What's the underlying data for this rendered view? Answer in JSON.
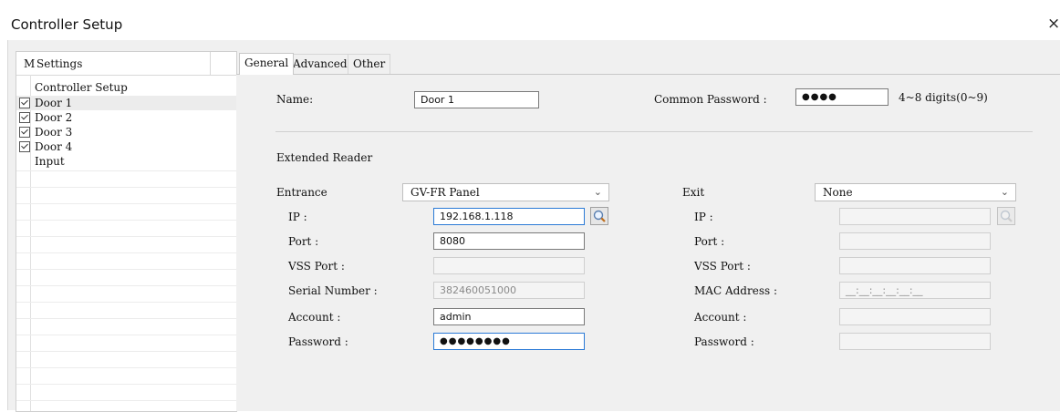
{
  "window": {
    "title": "Controller Setup",
    "close": "×"
  },
  "left_panel": {
    "header_m": "M",
    "header_settings": "Settings",
    "items": [
      {
        "label": "Controller Setup",
        "checked": false
      },
      {
        "label": "Door 1",
        "checked": true
      },
      {
        "label": "Door 2",
        "checked": true
      },
      {
        "label": "Door 3",
        "checked": true
      },
      {
        "label": "Door 4",
        "checked": true
      },
      {
        "label": "Input",
        "checked": false
      }
    ]
  },
  "tabs": [
    "General",
    "Advanced",
    "Other"
  ],
  "general": {
    "name_label": "Name:",
    "name_value": "Door 1",
    "common_password_label": "Common Password :",
    "common_password_value": "●●●●",
    "common_password_hint": "4~8 digits(0~9)",
    "extended_reader_label": "Extended Reader"
  },
  "entrance": {
    "label": "Entrance",
    "reader_value": "GV-FR Panel",
    "ip_label": "IP :",
    "ip_value": "192.168.1.118",
    "port_label": "Port :",
    "port_value": "8080",
    "vss_port_label": "VSS Port :",
    "vss_port_value": "",
    "serial_label": "Serial Number :",
    "serial_value": "382460051000",
    "account_label": "Account :",
    "account_value": "admin",
    "password_label": "Password :",
    "password_value": "●●●●●●●●"
  },
  "exit": {
    "label": "Exit",
    "reader_value": "None",
    "ip_label": "IP :",
    "port_label": "Port :",
    "vss_port_label": "VSS Port :",
    "mac_label": "MAC Address :",
    "mac_value": "__:__:__:__:__:__",
    "account_label": "Account :",
    "password_label": "Password :"
  },
  "icons": {
    "search": "search-icon",
    "dropdown": "chevron-down-icon",
    "check": "checkbox-checked-icon"
  },
  "colors": {
    "panel_bg": "#f0f0f0",
    "focus_border": "#2b7ad6",
    "selected_row": "#ececec"
  }
}
